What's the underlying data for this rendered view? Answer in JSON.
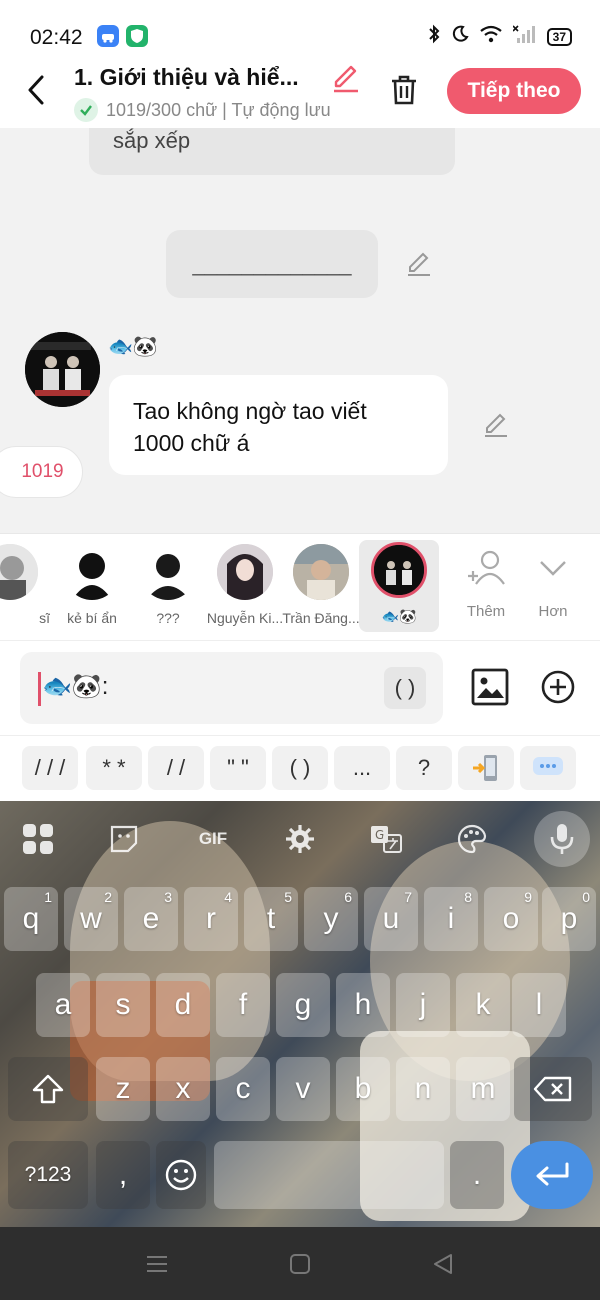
{
  "status_bar": {
    "time": "02:42",
    "battery": "37"
  },
  "header": {
    "title": "1. Giới thiệu và hiể...",
    "subtitle": "1019/300 chữ | Tự động lưu",
    "next_label": "Tiếp theo"
  },
  "chat": {
    "prev_bubble": "sắp xếp",
    "narration": "_____________",
    "character_name": "🐟🐼",
    "message": "Tao không ngờ tao viết 1000 chữ á",
    "count_tag": "1019"
  },
  "characters": [
    {
      "name": "sĩ"
    },
    {
      "name": "kẻ bí ẩn"
    },
    {
      "name": "???"
    },
    {
      "name": "Nguyễn Ki..."
    },
    {
      "name": "Trần Đăng..."
    },
    {
      "name": "🐟🐼"
    }
  ],
  "strip_actions": {
    "add_label": "Thêm",
    "more_label": "Hơn"
  },
  "input": {
    "value": "🐟🐼:",
    "paren_label": "( )"
  },
  "quick_symbols": [
    "/ / /",
    "* *",
    "/ /",
    "\" \"",
    "( )",
    "...",
    "?"
  ],
  "keyboard": {
    "row1": [
      {
        "k": "q",
        "h": "1"
      },
      {
        "k": "w",
        "h": "2"
      },
      {
        "k": "e",
        "h": "3"
      },
      {
        "k": "r",
        "h": "4"
      },
      {
        "k": "t",
        "h": "5"
      },
      {
        "k": "y",
        "h": "6"
      },
      {
        "k": "u",
        "h": "7"
      },
      {
        "k": "i",
        "h": "8"
      },
      {
        "k": "o",
        "h": "9"
      },
      {
        "k": "p",
        "h": "0"
      }
    ],
    "row2": [
      "a",
      "s",
      "d",
      "f",
      "g",
      "h",
      "j",
      "k",
      "l"
    ],
    "row3": [
      "z",
      "x",
      "c",
      "v",
      "b",
      "n",
      "m"
    ],
    "symbols_key": "?123",
    "comma_key": ",",
    "period_key": ".",
    "gif_label": "GIF"
  }
}
